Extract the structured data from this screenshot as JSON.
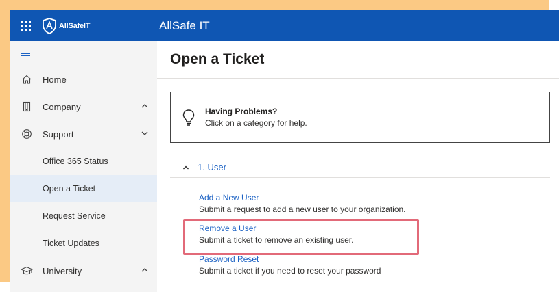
{
  "header": {
    "logo_text": "AllSafeIT",
    "site_title": "AllSafe IT"
  },
  "sidebar": {
    "items": [
      {
        "label": "Home"
      },
      {
        "label": "Company"
      },
      {
        "label": "Support"
      },
      {
        "label": "Office 365 Status"
      },
      {
        "label": "Open a Ticket"
      },
      {
        "label": "Request Service"
      },
      {
        "label": "Ticket Updates"
      },
      {
        "label": "University"
      }
    ]
  },
  "main": {
    "title": "Open a Ticket",
    "help": {
      "title": "Having Problems?",
      "desc": "Click on a category for help."
    },
    "section": {
      "label": "1. User"
    },
    "links": [
      {
        "title": "Add a New User",
        "desc": "Submit a request to add a new user to your organization."
      },
      {
        "title": "Remove a User",
        "desc": "Submit a ticket to remove an existing user."
      },
      {
        "title": "Password Reset",
        "desc": "Submit a ticket if you need to reset your password"
      }
    ]
  },
  "colors": {
    "brand": "#0f56b3",
    "accent": "#1c62c4",
    "highlight": "#e26a79",
    "background_deco": "#fbc984"
  },
  "icons": [
    "waffle-icon",
    "shield-logo-icon",
    "hamburger-icon",
    "home-icon",
    "building-icon",
    "lifebuoy-icon",
    "graduation-cap-icon",
    "chevron-up-icon",
    "chevron-down-icon",
    "lightbulb-icon"
  ]
}
